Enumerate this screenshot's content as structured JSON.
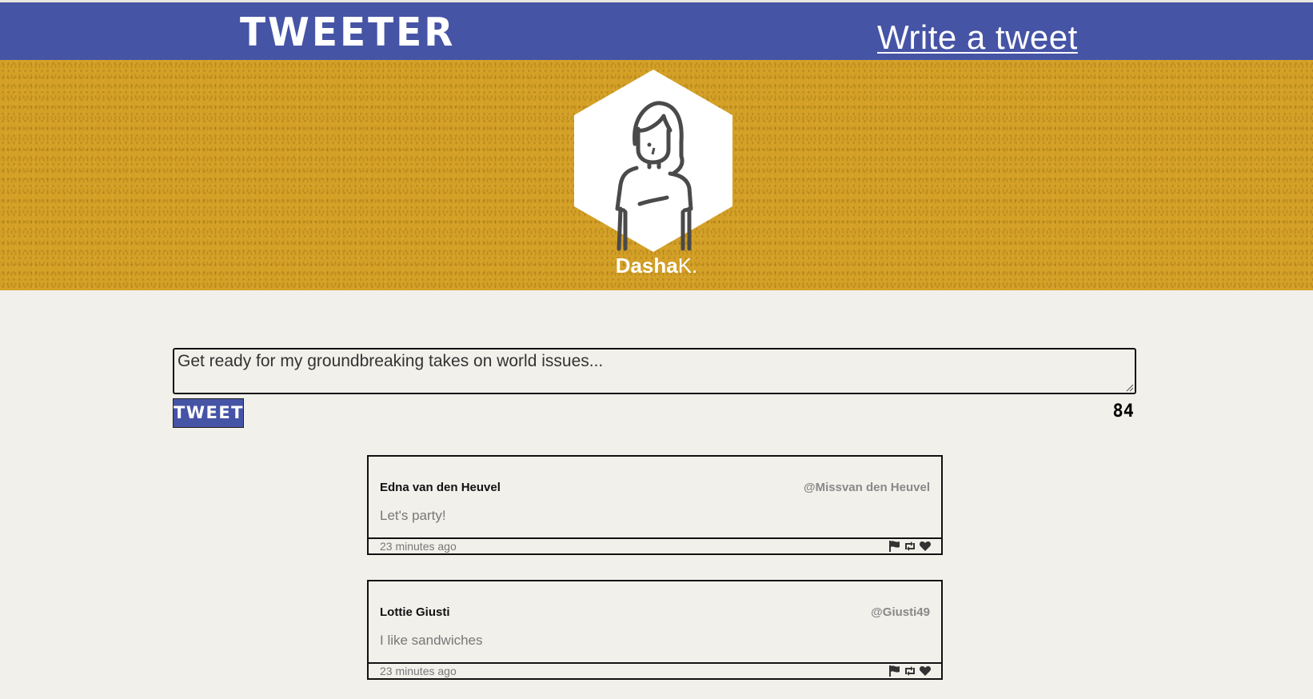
{
  "nav": {
    "brand": "TWEETER",
    "write_link": "Write a tweet"
  },
  "profile": {
    "first_name": "Dasha",
    "last_name": "K."
  },
  "composer": {
    "placeholder": "Get ready for my groundbreaking takes on world issues...",
    "submit_label": "TWEET",
    "counter": "84"
  },
  "tweets": [
    {
      "author": "Edna van den Heuvel",
      "handle": "@Missvan den Heuvel",
      "content": "Let's party!",
      "time": "23 minutes ago"
    },
    {
      "author": "Lottie Giusti",
      "handle": "@Giusti49",
      "content": "I like sandwiches",
      "time": "23 minutes ago"
    }
  ],
  "icons": {
    "tweet_actions": [
      "flag-icon",
      "retweet-icon",
      "heart-icon"
    ]
  },
  "colors": {
    "nav": "#4654a6",
    "hero": "#d4a026",
    "page": "#f2f0eb"
  }
}
